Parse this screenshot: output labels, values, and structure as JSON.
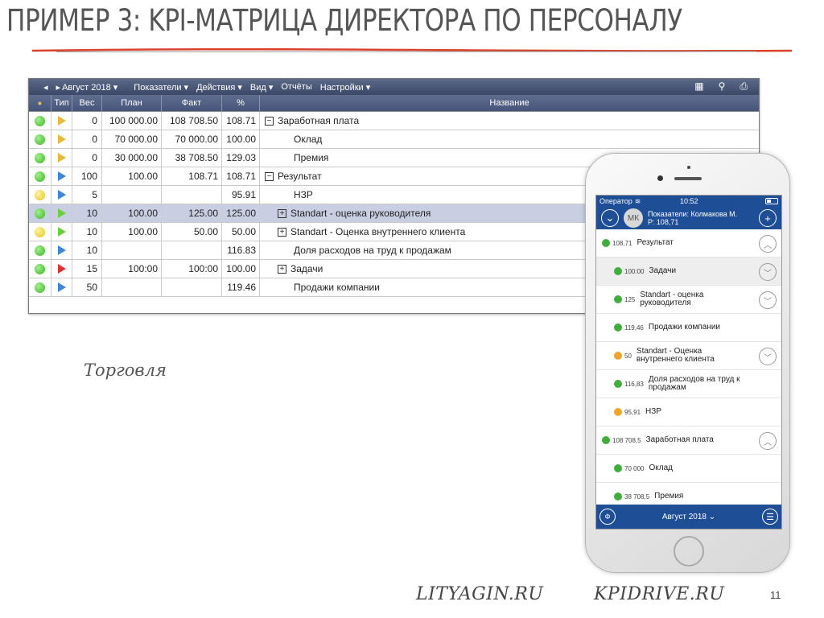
{
  "slide": {
    "title": "ПРИМЕР 3: KPI-МАТРИЦА ДИРЕКТОРА ПО ПЕРСОНАЛУ",
    "caption": "Торговля",
    "footer_left": "LITYAGIN.RU",
    "footer_right": "KPIDRIVE.RU",
    "page_number": "11",
    "accent_color": "#d9412b"
  },
  "menu": {
    "month": "Август 2018 ▾",
    "items": [
      "Показатели ▾",
      "Действия ▾",
      "Вид ▾",
      "Отчёты",
      "Настройки ▾"
    ],
    "tool_icons": [
      "table-icon",
      "search-icon",
      "print-icon"
    ]
  },
  "table": {
    "headers": {
      "status": "",
      "type": "Тип",
      "weight": "Вес",
      "plan": "План",
      "fact": "Факт",
      "percent": "%",
      "name": "Название"
    },
    "rows": [
      {
        "status": "green",
        "type": "yellow",
        "weight": "0",
        "plan": "100 000.00",
        "fact": "108 708.50",
        "percent": "108.71",
        "toggle": "−",
        "name": "Заработная плата"
      },
      {
        "status": "green",
        "type": "yellow",
        "weight": "0",
        "plan": "70 000.00",
        "fact": "70 000.00",
        "percent": "100.00",
        "toggle": "",
        "name": "Оклад"
      },
      {
        "status": "green",
        "type": "yellow",
        "weight": "0",
        "plan": "30 000.00",
        "fact": "38 708.50",
        "percent": "129.03",
        "toggle": "",
        "name": "Премия"
      },
      {
        "status": "green",
        "type": "blue",
        "weight": "100",
        "plan": "100.00",
        "fact": "108.71",
        "percent": "108.71",
        "toggle": "−",
        "name": "Результат"
      },
      {
        "status": "yellow",
        "type": "blue",
        "weight": "5",
        "plan": "",
        "fact": "",
        "percent": "95.91",
        "toggle": "",
        "name": "НЗР"
      },
      {
        "status": "green",
        "type": "green",
        "weight": "10",
        "plan": "100.00",
        "fact": "125.00",
        "percent": "125.00",
        "toggle": "+",
        "name": "Standart - оценка руководителя"
      },
      {
        "status": "yellow",
        "type": "green",
        "weight": "10",
        "plan": "100.00",
        "fact": "50.00",
        "percent": "50.00",
        "toggle": "+",
        "name": "Standart - Оценка внутреннего клиента"
      },
      {
        "status": "green",
        "type": "blue",
        "weight": "10",
        "plan": "",
        "fact": "",
        "percent": "116.83",
        "toggle": "",
        "name": "Доля расходов на труд к продажам"
      },
      {
        "status": "green",
        "type": "red",
        "weight": "15",
        "plan": "100:00",
        "fact": "100:00",
        "percent": "100.00",
        "toggle": "+",
        "name": "Задачи"
      },
      {
        "status": "green",
        "type": "blue",
        "weight": "50",
        "plan": "",
        "fact": "",
        "percent": "119.46",
        "toggle": "",
        "name": "Продажи компании"
      }
    ]
  },
  "phone": {
    "carrier": "Оператор",
    "time": "10:52",
    "avatar": "МК",
    "header_line1": "Показатели: Колмакова М.",
    "header_line2": "Р: 108,71",
    "items": [
      {
        "color": "g",
        "value": "108,71",
        "label": "Результат",
        "chevron": "up",
        "indent": 0
      },
      {
        "color": "g",
        "value": "100:00",
        "label": "Задачи",
        "chevron": "down",
        "indent": 1
      },
      {
        "color": "g",
        "value": "125",
        "label": "Standart - оценка руководителя",
        "chevron": "down",
        "indent": 1
      },
      {
        "color": "g",
        "value": "119,46",
        "label": "Продажи компании",
        "chevron": "",
        "indent": 1
      },
      {
        "color": "o",
        "value": "50",
        "label": "Standart - Оценка внутреннего клиента",
        "chevron": "down",
        "indent": 1
      },
      {
        "color": "g",
        "value": "116,83",
        "label": "Доля расходов на труд к продажам",
        "chevron": "",
        "indent": 1
      },
      {
        "color": "o",
        "value": "95,91",
        "label": "НЗР",
        "chevron": "",
        "indent": 1
      },
      {
        "color": "g",
        "value": "108 708,5",
        "label": "Заработная плата",
        "chevron": "up",
        "indent": 0
      },
      {
        "color": "g",
        "value": "70 000",
        "label": "Оклад",
        "chevron": "",
        "indent": 1
      },
      {
        "color": "g",
        "value": "38 708,5",
        "label": "Премия",
        "chevron": "",
        "indent": 1
      }
    ],
    "bottom_left": "Ф",
    "bottom_month": "Август 2018 ⌄"
  }
}
